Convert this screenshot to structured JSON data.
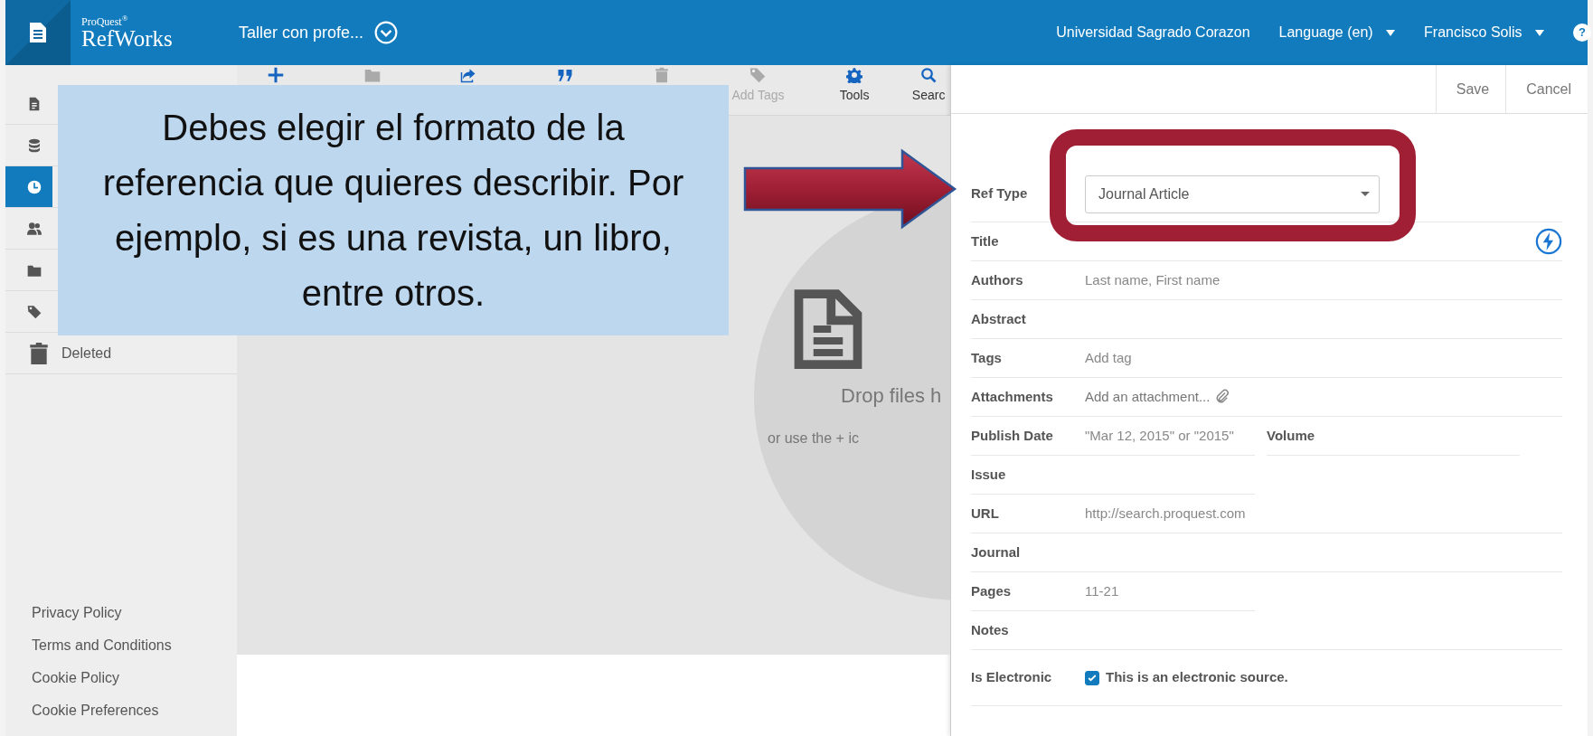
{
  "header": {
    "brand_small": "ProQuest$^{®}$",
    "brand": "RefWorks",
    "project": "Taller con profe...",
    "institution": "Universidad Sagrado Corazon",
    "menus": [
      {
        "label": "Language (en)"
      },
      {
        "label": "Francisco Solis"
      }
    ],
    "help": "?"
  },
  "sidebar": {
    "items": [
      {
        "kind": "document",
        "selected": false
      },
      {
        "kind": "database",
        "selected": false
      },
      {
        "kind": "clock",
        "selected": true
      },
      {
        "kind": "people",
        "selected": false
      },
      {
        "kind": "folder",
        "selected": false
      },
      {
        "kind": "tag",
        "selected": false
      },
      {
        "kind": "trash",
        "label": "Deleted",
        "selected": false
      }
    ],
    "footer_links": [
      "Privacy Policy",
      "Terms and Conditions",
      "Cookie Policy",
      "Cookie Preferences"
    ]
  },
  "toolbar": [
    {
      "kind": "plus",
      "disabled": false
    },
    {
      "kind": "folder",
      "disabled": true
    },
    {
      "kind": "share",
      "disabled": false
    },
    {
      "kind": "quote",
      "disabled": false
    },
    {
      "kind": "trash",
      "disabled": true
    },
    {
      "kind": "tag",
      "label": "Add Tags",
      "disabled": true
    },
    {
      "kind": "gear",
      "label": "Tools",
      "disabled": false
    },
    {
      "kind": "search",
      "label": "Searc",
      "disabled": false
    }
  ],
  "drop_zone": {
    "title": "Drop files h",
    "hint": "or use the + ic"
  },
  "panel": {
    "buttons": [
      "Save",
      "Cancel"
    ],
    "fields": [
      {
        "kind": "select",
        "label": "Ref Type",
        "value": "Journal Article"
      },
      {
        "kind": "text",
        "label": "Title",
        "quick_fill": true
      },
      {
        "kind": "text",
        "label": "Authors",
        "placeholder": "Last name, First name"
      },
      {
        "kind": "text",
        "label": "Abstract"
      },
      {
        "kind": "text",
        "label": "Tags",
        "placeholder": "Add tag"
      },
      {
        "kind": "attachment",
        "label": "Attachments",
        "placeholder": "Add an attachment..."
      },
      {
        "kind": "pair",
        "label": "Publish Date",
        "placeholder": "\"Mar 12, 2015\" or \"2015\"",
        "second_label": "Volume"
      },
      {
        "kind": "text",
        "label": "Issue",
        "half": true
      },
      {
        "kind": "text",
        "label": "URL",
        "placeholder": "http://search.proquest.com"
      },
      {
        "kind": "text",
        "label": "Journal"
      },
      {
        "kind": "text",
        "label": "Pages",
        "placeholder": "11-21",
        "half": true
      },
      {
        "kind": "text",
        "label": "Notes"
      },
      {
        "kind": "checkbox",
        "label": "Is Electronic",
        "text": "This is an electronic source.",
        "checked": true
      }
    ]
  },
  "callout": {
    "text": "Debes elegir el formato de la referencia que quieres describir. Por ejemplo, si es una revista, un libro, entre otros."
  }
}
